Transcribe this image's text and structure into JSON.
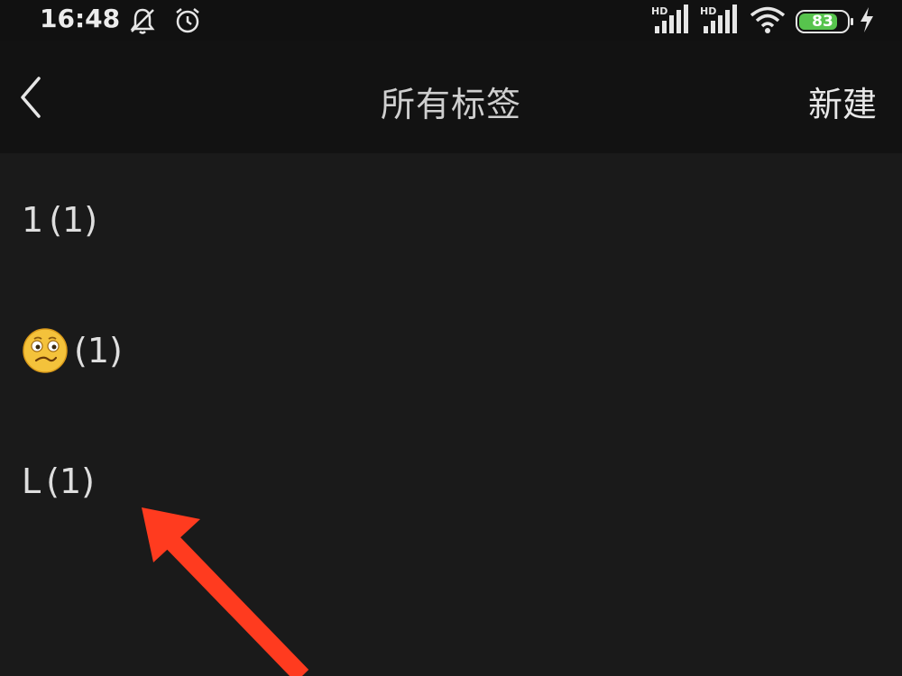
{
  "status_bar": {
    "time": "16:48",
    "signal_badge_1": "HD",
    "signal_badge_2": "HD",
    "battery_level": "83",
    "battery_color": "#57c44d"
  },
  "nav": {
    "title": "所有标签",
    "new_label": "新建"
  },
  "tags": [
    {
      "name": "1",
      "count": "(1)"
    },
    {
      "name": "",
      "emoji": "confused-face-icon",
      "count": "(1)"
    },
    {
      "name": "L",
      "count": "(1)"
    }
  ],
  "annotation": {
    "color": "#ff3b1f"
  }
}
